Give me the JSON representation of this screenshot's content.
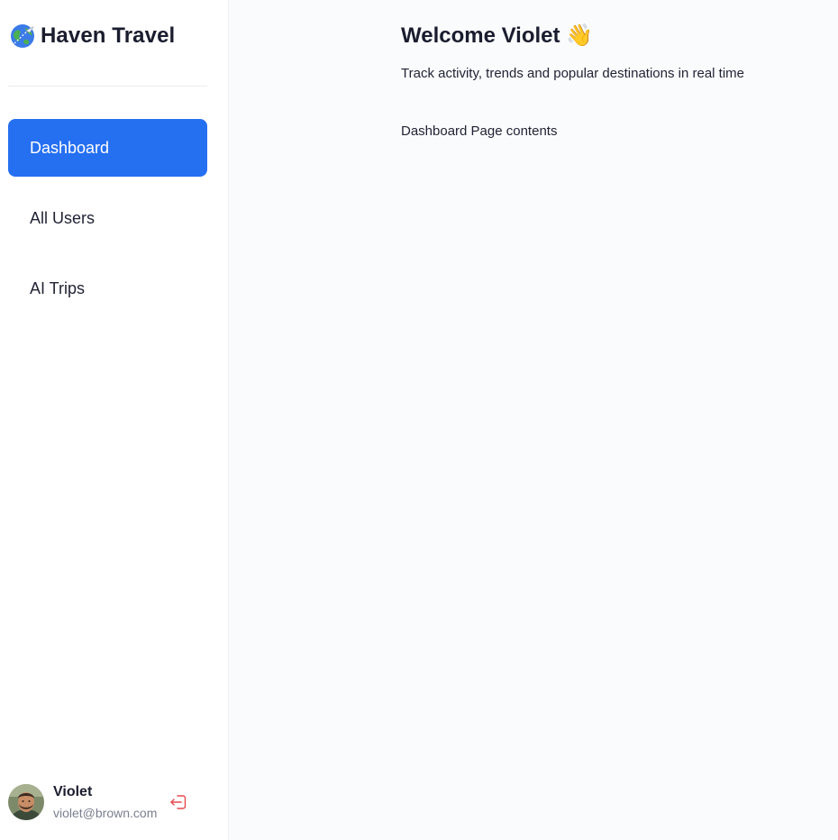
{
  "brand": {
    "name": "Haven Travel",
    "logo_icon": "globe-airplane-icon"
  },
  "sidebar": {
    "items": [
      {
        "label": "Dashboard",
        "active": true
      },
      {
        "label": "All Users",
        "active": false
      },
      {
        "label": "AI Trips",
        "active": false
      }
    ]
  },
  "user": {
    "name": "Violet",
    "email": "violet@brown.com",
    "avatar_icon": "user-avatar",
    "logout_icon": "logout-icon"
  },
  "main": {
    "welcome": "Welcome Violet 👋",
    "subtitle": "Track activity, trends and popular destinations in real time",
    "contents": "Dashboard Page contents"
  },
  "colors": {
    "accent": "#256ff1",
    "logout": "#e5484d",
    "page_bg": "#fafbfd",
    "sidebar_bg": "#ffffff"
  }
}
